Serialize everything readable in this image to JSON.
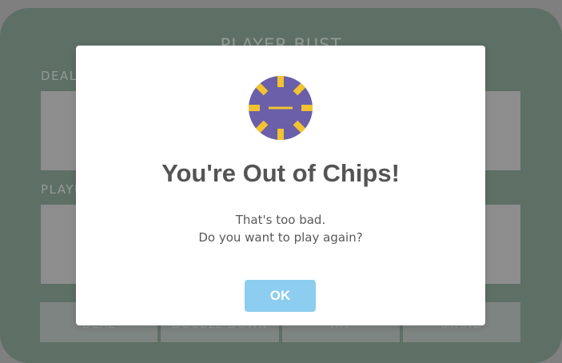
{
  "table": {
    "status": "PLAYER BUST",
    "dealer_label": "DEALER",
    "player_label": "PLAYER",
    "controls": [
      "DEAL",
      "DOUBLE DOWN",
      "HIT",
      "STAND"
    ]
  },
  "modal": {
    "icon": "poker-chip-icon",
    "title": "You're Out of Chips!",
    "line1": "That's too bad.",
    "line2": "Do you want to play again?",
    "ok_label": "OK"
  },
  "colors": {
    "felt": "#3c5e4c",
    "chip_body": "#6a5fa8",
    "chip_stripe": "#f2c230",
    "ok_button": "#8ccdf0"
  }
}
